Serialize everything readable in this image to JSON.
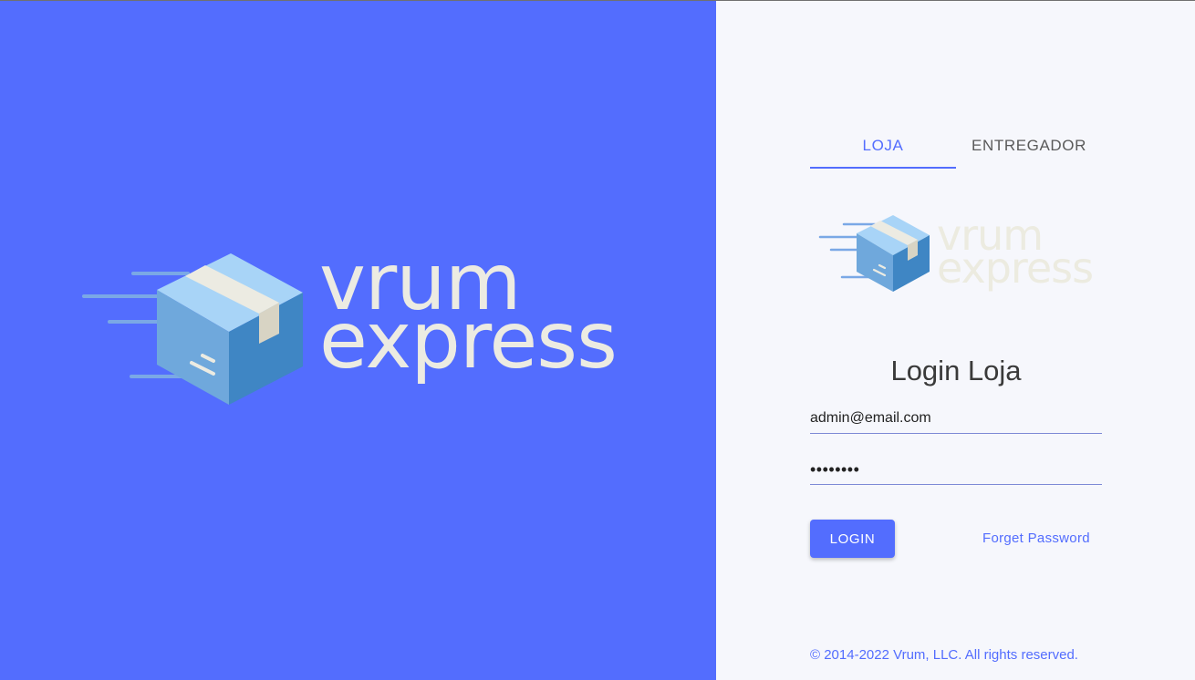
{
  "brand": {
    "logo_line1": "vrum",
    "logo_line2": "express",
    "logo_icon": "shipping-box-icon"
  },
  "tabs": [
    {
      "label": "LOJA",
      "active": true
    },
    {
      "label": "ENTREGADOR",
      "active": false
    }
  ],
  "form": {
    "title": "Login Loja",
    "email_value": "admin@email.com",
    "password_value": "••••••••",
    "login_label": "LOGIN",
    "forget_label": "Forget Password"
  },
  "footer": {
    "copyright": "© 2014-2022 Vrum, LLC. All rights reserved."
  },
  "colors": {
    "primary": "#536dfe",
    "panel_background": "#f6f7fc",
    "logo_text": "#ecebe2",
    "box_light": "#8ec6f2",
    "box_dark": "#3f86c4"
  }
}
